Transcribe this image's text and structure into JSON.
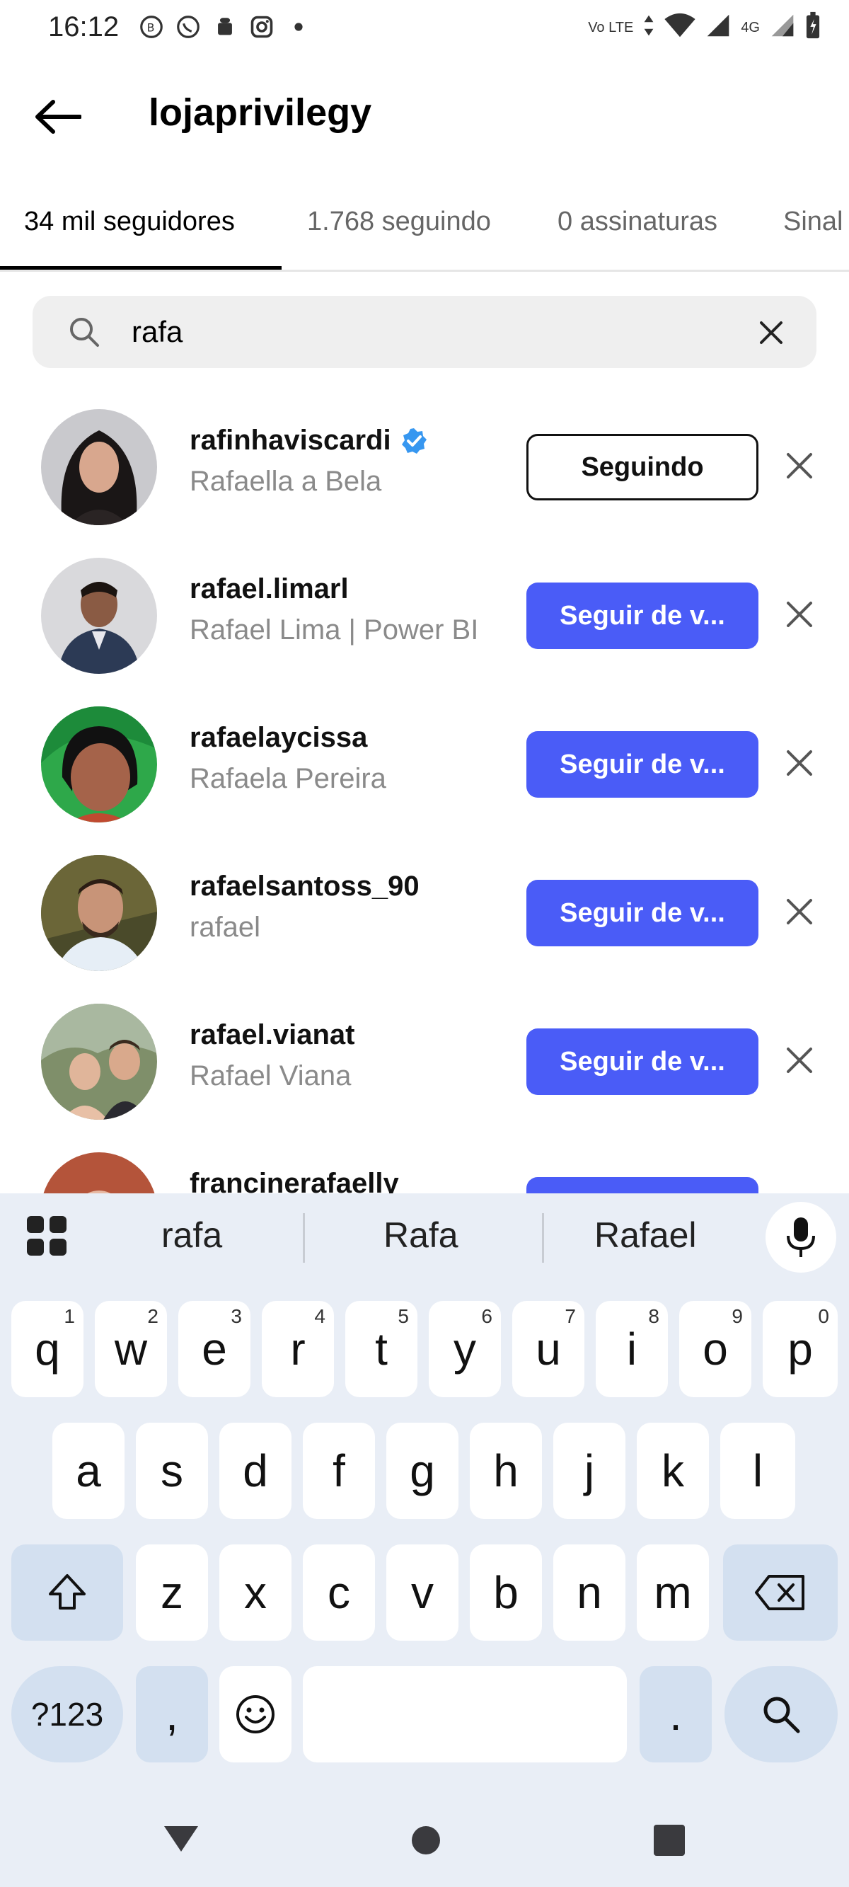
{
  "status_bar": {
    "time": "16:12",
    "left_icons": [
      "whatsapp-business-icon",
      "whatsapp-icon",
      "android-icon",
      "instagram-icon",
      "dot-icon"
    ],
    "volte": "Vo LTE",
    "network": "4G"
  },
  "header": {
    "title": "lojaprivilegy"
  },
  "tabs": [
    {
      "label": "34 mil seguidores",
      "active": true
    },
    {
      "label": "1.768 seguindo",
      "active": false
    },
    {
      "label": "0 assinaturas",
      "active": false
    },
    {
      "label": "Sinal",
      "active": false
    }
  ],
  "search": {
    "value": "rafa"
  },
  "users": [
    {
      "username": "rafinhaviscardi",
      "name": "Rafaella a Bela",
      "verified": true,
      "button": "Seguindo",
      "button_style": "following"
    },
    {
      "username": "rafael.limarl",
      "name": "Rafael Lima | Power BI",
      "verified": false,
      "button": "Seguir de v...",
      "button_style": "follow"
    },
    {
      "username": "rafaelaycissa",
      "name": "Rafaela Pereira",
      "verified": false,
      "button": "Seguir de v...",
      "button_style": "follow"
    },
    {
      "username": "rafaelsantoss_90",
      "name": "rafael",
      "verified": false,
      "button": "Seguir de v...",
      "button_style": "follow"
    },
    {
      "username": "rafael.vianat",
      "name": "Rafael Viana",
      "verified": false,
      "button": "Seguir de v...",
      "button_style": "follow"
    },
    {
      "username": "francinerafaelly",
      "name": "",
      "verified": false,
      "button": "",
      "button_style": "follow"
    }
  ],
  "keyboard": {
    "suggestions": [
      "rafa",
      "Rafa",
      "Rafael"
    ],
    "row1": [
      {
        "k": "q",
        "n": "1"
      },
      {
        "k": "w",
        "n": "2"
      },
      {
        "k": "e",
        "n": "3"
      },
      {
        "k": "r",
        "n": "4"
      },
      {
        "k": "t",
        "n": "5"
      },
      {
        "k": "y",
        "n": "6"
      },
      {
        "k": "u",
        "n": "7"
      },
      {
        "k": "i",
        "n": "8"
      },
      {
        "k": "o",
        "n": "9"
      },
      {
        "k": "p",
        "n": "0"
      }
    ],
    "row2": [
      "a",
      "s",
      "d",
      "f",
      "g",
      "h",
      "j",
      "k",
      "l"
    ],
    "row3": [
      "z",
      "x",
      "c",
      "v",
      "b",
      "n",
      "m"
    ],
    "symbols_label": "?123",
    "comma": ",",
    "period": "."
  },
  "colors": {
    "follow_button": "#4a5cf7",
    "verified_badge": "#3797f0",
    "keyboard_bg": "#e9eef6",
    "special_key": "#d3e0f0"
  }
}
